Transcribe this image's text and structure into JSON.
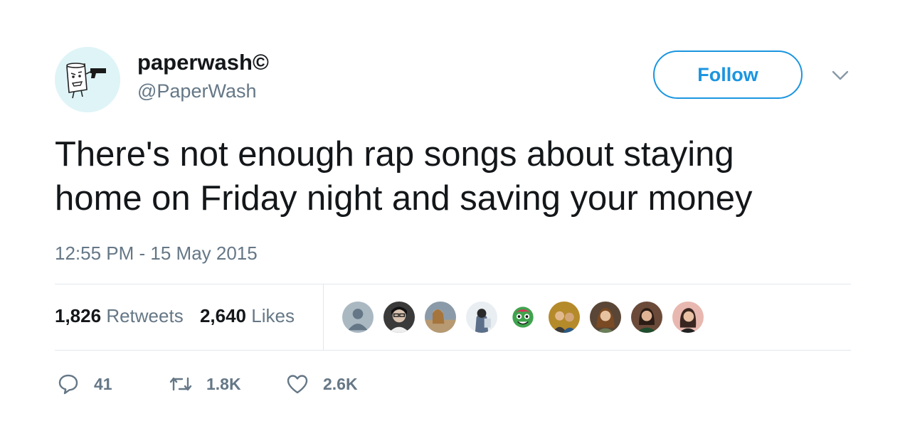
{
  "user": {
    "display_name": "paperwash©",
    "handle": "@PaperWash",
    "avatar_icon": "paper-roll-with-gun-icon"
  },
  "follow_label": "Follow",
  "tweet": {
    "text": "There's not enough rap songs about staying\nhome on Friday night and saving your money",
    "timestamp": "12:55 PM - 15 May 2015"
  },
  "stats": {
    "retweets_count": "1,826",
    "retweets_label": "Retweets",
    "likes_count": "2,640",
    "likes_label": "Likes"
  },
  "likers": [
    {
      "name": "default-avatar",
      "color": "#aab8c2"
    },
    {
      "name": "liker-avatar",
      "color": "#3a3a3a"
    },
    {
      "name": "liker-avatar",
      "color": "#8a9aa8"
    },
    {
      "name": "liker-avatar",
      "color": "#5b6f8a"
    },
    {
      "name": "liker-avatar",
      "color": "#3fa34d"
    },
    {
      "name": "liker-avatar",
      "color": "#b58a2a"
    },
    {
      "name": "liker-avatar",
      "color": "#5a4636"
    },
    {
      "name": "liker-avatar",
      "color": "#6b4a3a"
    },
    {
      "name": "liker-avatar",
      "color": "#e8b8b0"
    }
  ],
  "actions": {
    "reply_count": "41",
    "retweet_count": "1.8K",
    "like_count": "2.6K"
  },
  "colors": {
    "accent": "#1b95e0",
    "muted": "#657786",
    "text": "#14171a",
    "divider": "#e1e8ed"
  }
}
